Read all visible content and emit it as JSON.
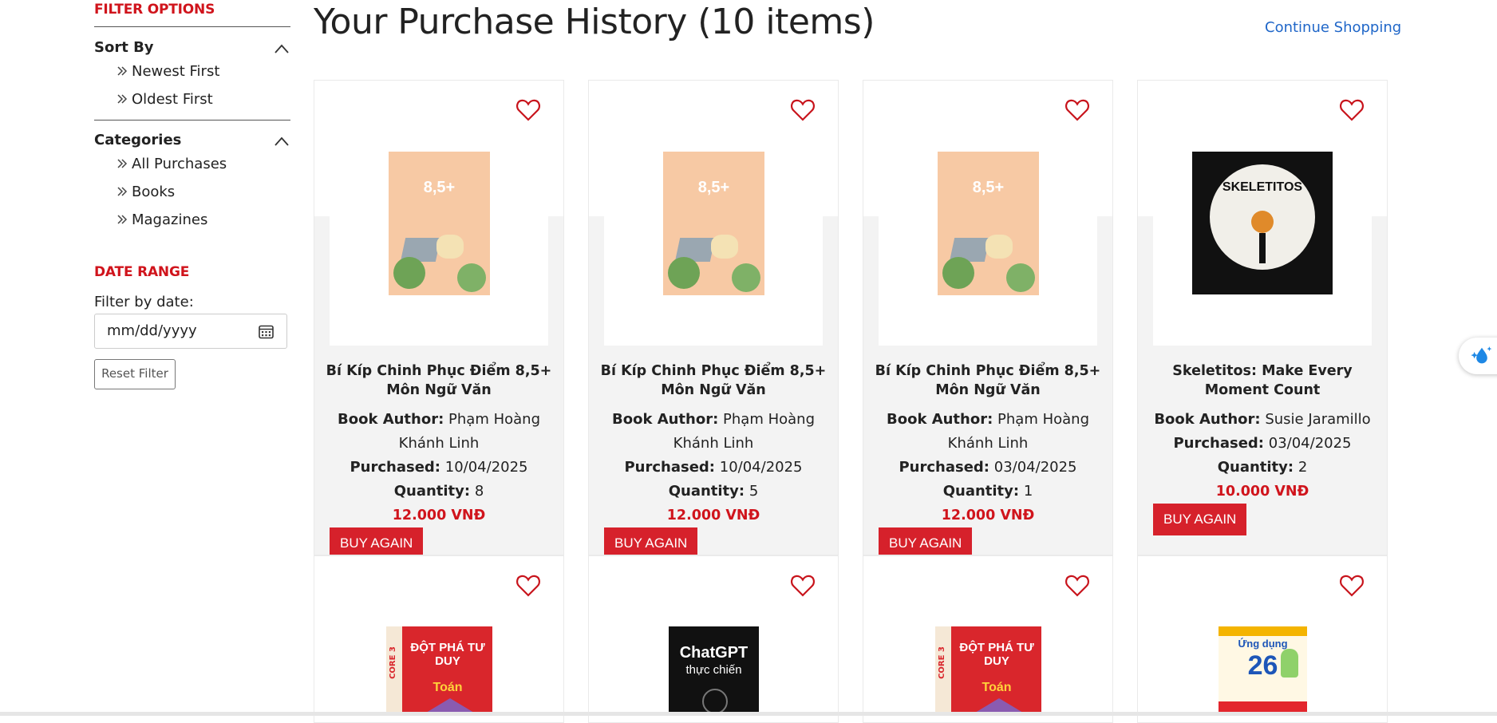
{
  "sidebar": {
    "filter_title": "FILTER OPTIONS",
    "sort": {
      "heading": "Sort By",
      "options": [
        "Newest First",
        "Oldest First"
      ]
    },
    "categories": {
      "heading": "Categories",
      "options": [
        "All Purchases",
        "Books",
        "Magazines"
      ]
    },
    "date_range": {
      "title": "DATE RANGE",
      "label": "Filter by date:",
      "placeholder": "mm/dd/yyyy",
      "reset_label": "Reset Filter"
    }
  },
  "header": {
    "title": "Your Purchase History (10 items)",
    "continue_link": "Continue Shopping"
  },
  "labels": {
    "author": "Book Author:",
    "purchased": "Purchased:",
    "quantity": "Quantity:",
    "buy_again": "BUY AGAIN"
  },
  "colors": {
    "accent_red": "#d0141c",
    "link_blue": "#1f66c8"
  },
  "products": [
    {
      "title": "Bí Kíp Chinh Phục Điểm 8,5+ Môn Ngữ Văn",
      "author": "Phạm Hoàng Khánh Linh",
      "purchased": "10/04/2025",
      "quantity": "8",
      "price": "12.000 VNĐ",
      "cover_icon": "book-cover-bi-kip-ngu-van",
      "cover_text": "8,5+"
    },
    {
      "title": "Bí Kíp Chinh Phục Điểm 8,5+ Môn Ngữ Văn",
      "author": "Phạm Hoàng Khánh Linh",
      "purchased": "10/04/2025",
      "quantity": "5",
      "price": "12.000 VNĐ",
      "cover_icon": "book-cover-bi-kip-ngu-van",
      "cover_text": "8,5+"
    },
    {
      "title": "Bí Kíp Chinh Phục Điểm 8,5+ Môn Ngữ Văn",
      "author": "Phạm Hoàng Khánh Linh",
      "purchased": "03/04/2025",
      "quantity": "1",
      "price": "12.000 VNĐ",
      "cover_icon": "book-cover-bi-kip-ngu-van",
      "cover_text": "8,5+"
    },
    {
      "title": "Skeletitos: Make Every Moment Count",
      "author": "Susie Jaramillo",
      "purchased": "03/04/2025",
      "quantity": "2",
      "price": "10.000 VNĐ",
      "cover_icon": "book-cover-skeletitos",
      "cover_text": "SKELETITOS"
    },
    {
      "cover_icon": "book-cover-dot-pha-tu-duy-toan",
      "cover_text": "ĐỘT PHÁ TƯ DUY",
      "cover_sub": "Toán",
      "cover_side": "CORE 3"
    },
    {
      "cover_icon": "book-cover-chatgpt-thuc-chien",
      "cover_text": "ChatGPT",
      "cover_sub": "thực chiến"
    },
    {
      "cover_icon": "book-cover-dot-pha-tu-duy-toan",
      "cover_text": "ĐỘT PHÁ TƯ DUY",
      "cover_sub": "Toán",
      "cover_side": "CORE 3"
    },
    {
      "cover_icon": "book-cover-ung-dung-26-hoa-hoc",
      "cover_text": "Ứng dụng",
      "cover_sub": "26"
    }
  ]
}
